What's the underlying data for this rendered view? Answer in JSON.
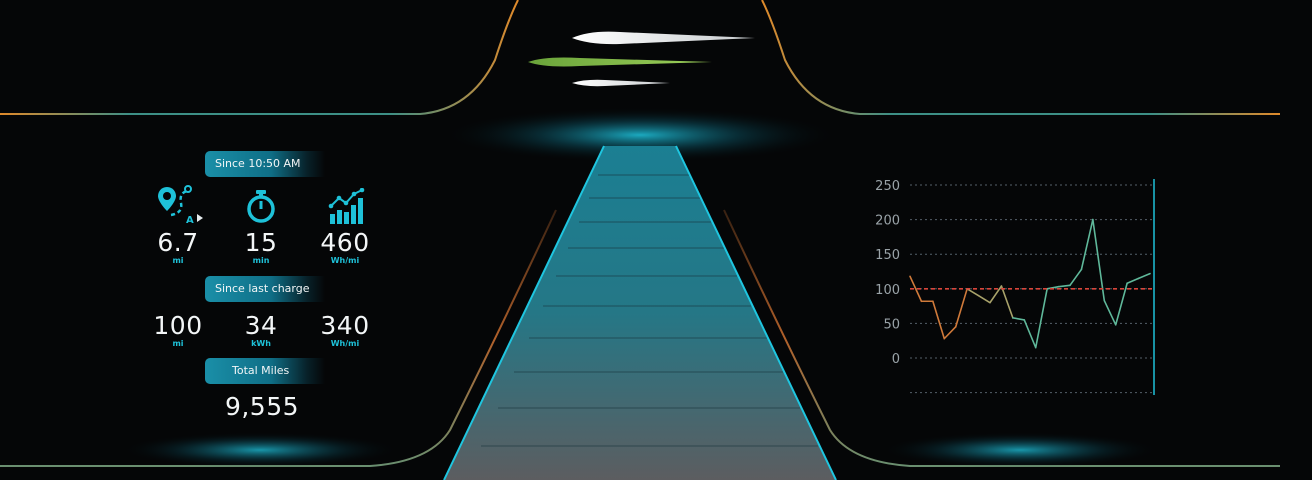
{
  "colors": {
    "accent": "#1ec1d8",
    "pill": "#1a8fa8",
    "orange_line": "#e08a2a",
    "blue_line": "#2a5fd0",
    "chart_low": "#d07a3a",
    "chart_high": "#5fb89a",
    "target_line": "#d9453a"
  },
  "trip": {
    "since_time_label": "Since 10:50 AM",
    "distance": {
      "value": "6.7",
      "unit": "mi",
      "icon": "route-pin-icon"
    },
    "duration": {
      "value": "15",
      "unit": "min",
      "icon": "stopwatch-icon"
    },
    "efficiency": {
      "value": "460",
      "unit": "Wh/mi",
      "icon": "bar-chart-trend-icon"
    }
  },
  "charge": {
    "label": "Since last charge",
    "distance": {
      "value": "100",
      "unit": "mi"
    },
    "energy": {
      "value": "34",
      "unit": "kWh"
    },
    "efficiency": {
      "value": "340",
      "unit": "Wh/mi"
    }
  },
  "odometer": {
    "label": "Total Miles",
    "value": "9,555"
  },
  "chart_data": {
    "type": "line",
    "yticks": [
      "250",
      "200",
      "150",
      "100",
      "50",
      "0"
    ],
    "ylim": [
      0,
      250
    ],
    "reference_line": 100,
    "values": [
      118,
      82,
      82,
      28,
      45,
      100,
      90,
      80,
      104,
      58,
      55,
      15,
      100,
      103,
      105,
      128,
      200,
      83,
      48,
      108,
      115,
      122
    ]
  }
}
